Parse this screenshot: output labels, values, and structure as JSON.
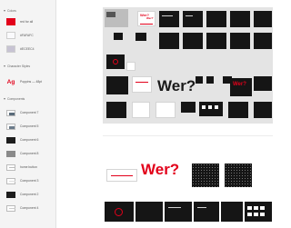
{
  "sidebar": {
    "colors": {
      "title": "Colors",
      "items": [
        {
          "label": "red for all",
          "hex": "#E2001A"
        },
        {
          "label": "#FAFAFC",
          "hex": "#FAFAFC"
        },
        {
          "label": "#ECEEC4",
          "hex": "#C7C3D3"
        }
      ]
    },
    "character_styles": {
      "title": "Character Styles",
      "items": [
        {
          "icon_text": "Ag",
          "label": "Poppins — 48pt"
        }
      ]
    },
    "components": {
      "title": "Components",
      "items": [
        {
          "label": "Component 7"
        },
        {
          "label": "Component 5"
        },
        {
          "label": "Component 6"
        },
        {
          "label": "Component 8"
        },
        {
          "label": "home button"
        },
        {
          "label": "Component 3"
        },
        {
          "label": "Component 2"
        },
        {
          "label": "Component 4"
        }
      ]
    }
  },
  "canvas": {
    "headline_word": "Wer?",
    "accent_color": "#E2001A",
    "board_color": "#E4E4E4"
  }
}
